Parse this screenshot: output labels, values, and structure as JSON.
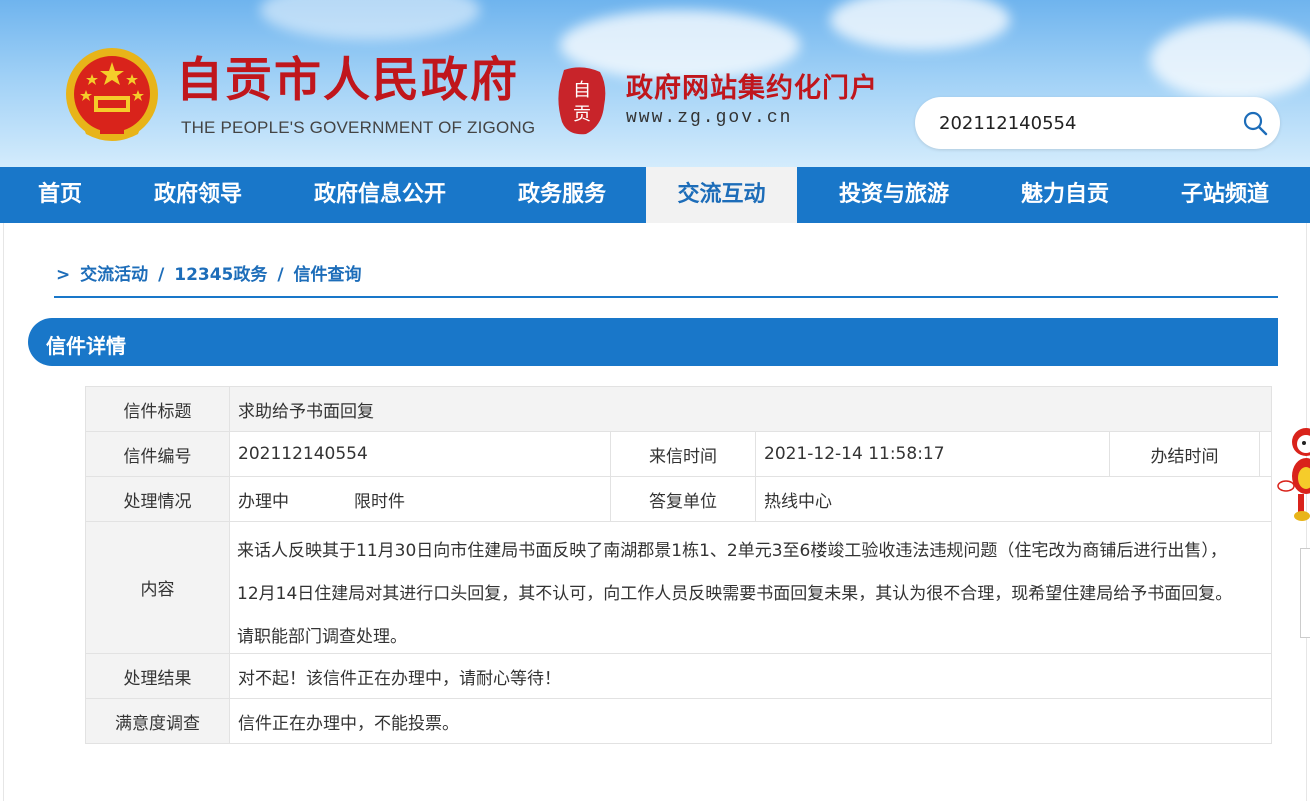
{
  "header": {
    "site_title": "自贡市人民政府",
    "site_subtitle": "THE PEOPLE'S GOVERNMENT OF ZIGONG",
    "portal_logo_text": "自贡",
    "portal_title": "政府网站集约化门户",
    "portal_url": "www.zg.gov.cn",
    "search": {
      "value": "202112140554",
      "placeholder": ""
    }
  },
  "nav": {
    "items": [
      {
        "label": "首页",
        "active": false
      },
      {
        "label": "政府领导",
        "active": false
      },
      {
        "label": "政府信息公开",
        "active": false
      },
      {
        "label": "政务服务",
        "active": false
      },
      {
        "label": "交流互动",
        "active": true
      },
      {
        "label": "投资与旅游",
        "active": false
      },
      {
        "label": "魅力自贡",
        "active": false
      },
      {
        "label": "子站频道",
        "active": false
      }
    ]
  },
  "breadcrumb": {
    "prefix": ">",
    "items": [
      "交流活动",
      "/",
      "12345政务",
      "/",
      "信件查询"
    ]
  },
  "section": {
    "title": "信件详情"
  },
  "letter": {
    "title_label": "信件标题",
    "title_value": "求助给予书面回复",
    "number_label": "信件编号",
    "number_value": "202112140554",
    "received_label": "来信时间",
    "received_value": "2021-12-14 11:58:17",
    "closed_label": "办结时间",
    "closed_value": "",
    "status_label": "处理情况",
    "status_value": "办理中",
    "limit_value": "限时件",
    "reply_unit_label": "答复单位",
    "reply_unit_value": "热线中心",
    "content_label": "内容",
    "content_lines": [
      "来话人反映其于11月30日向市住建局书面反映了南湖郡景1栋1、2单元3至6楼竣工验收违法违规问题（住宅改为商铺后进行出售），",
      "12月14日住建局对其进行口头回复，其不认可，向工作人员反映需要书面回复未果，其认为很不合理，现希望住建局给予书面回复。",
      "请职能部门调查处理。"
    ],
    "result_label": "处理结果",
    "result_value": "对不起！该信件正在办理中，请耐心等待！",
    "survey_label": "满意度调查",
    "survey_value": "信件正在办理中，不能投票。"
  },
  "colors": {
    "brand_red": "#c0161c",
    "nav_blue": "#1977c9",
    "active_tab_bg": "#f2f2f2",
    "label_bg": "#f3f3f3"
  },
  "icons": {
    "emblem": "national-emblem-icon",
    "portal_logo": "zigong-seal-icon",
    "search": "search-icon",
    "mascot": "mascot-icon"
  }
}
